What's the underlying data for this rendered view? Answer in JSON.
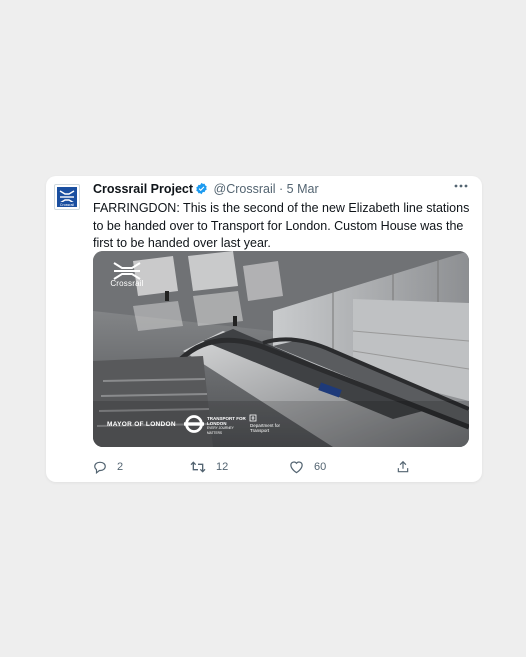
{
  "tweet": {
    "author_name": "Crossrail Project",
    "handle": "@Crossrail",
    "separator": "·",
    "date": "5 Mar",
    "avatar_label": "Crossrail",
    "text": "FARRINGDON: This is the second of the new Elizabeth line stations to be handed over to Transport for London. Custom House was the first to be handed over last year.",
    "verified": true,
    "accent_color": "#1d9bf0"
  },
  "media": {
    "logo_label": "Crossrail",
    "mayor_label": "MAYOR OF LONDON",
    "tfl_label": "TRANSPORT FOR LONDON",
    "tfl_sub": "EVERY JOURNEY MATTERS",
    "dft_label": "Department for Transport"
  },
  "actions": {
    "replies": "2",
    "retweets": "12",
    "likes": "60"
  },
  "icons": [
    "crossrail-logo",
    "verified-icon",
    "more-icon",
    "reply-icon",
    "retweet-icon",
    "like-icon",
    "share-icon"
  ]
}
